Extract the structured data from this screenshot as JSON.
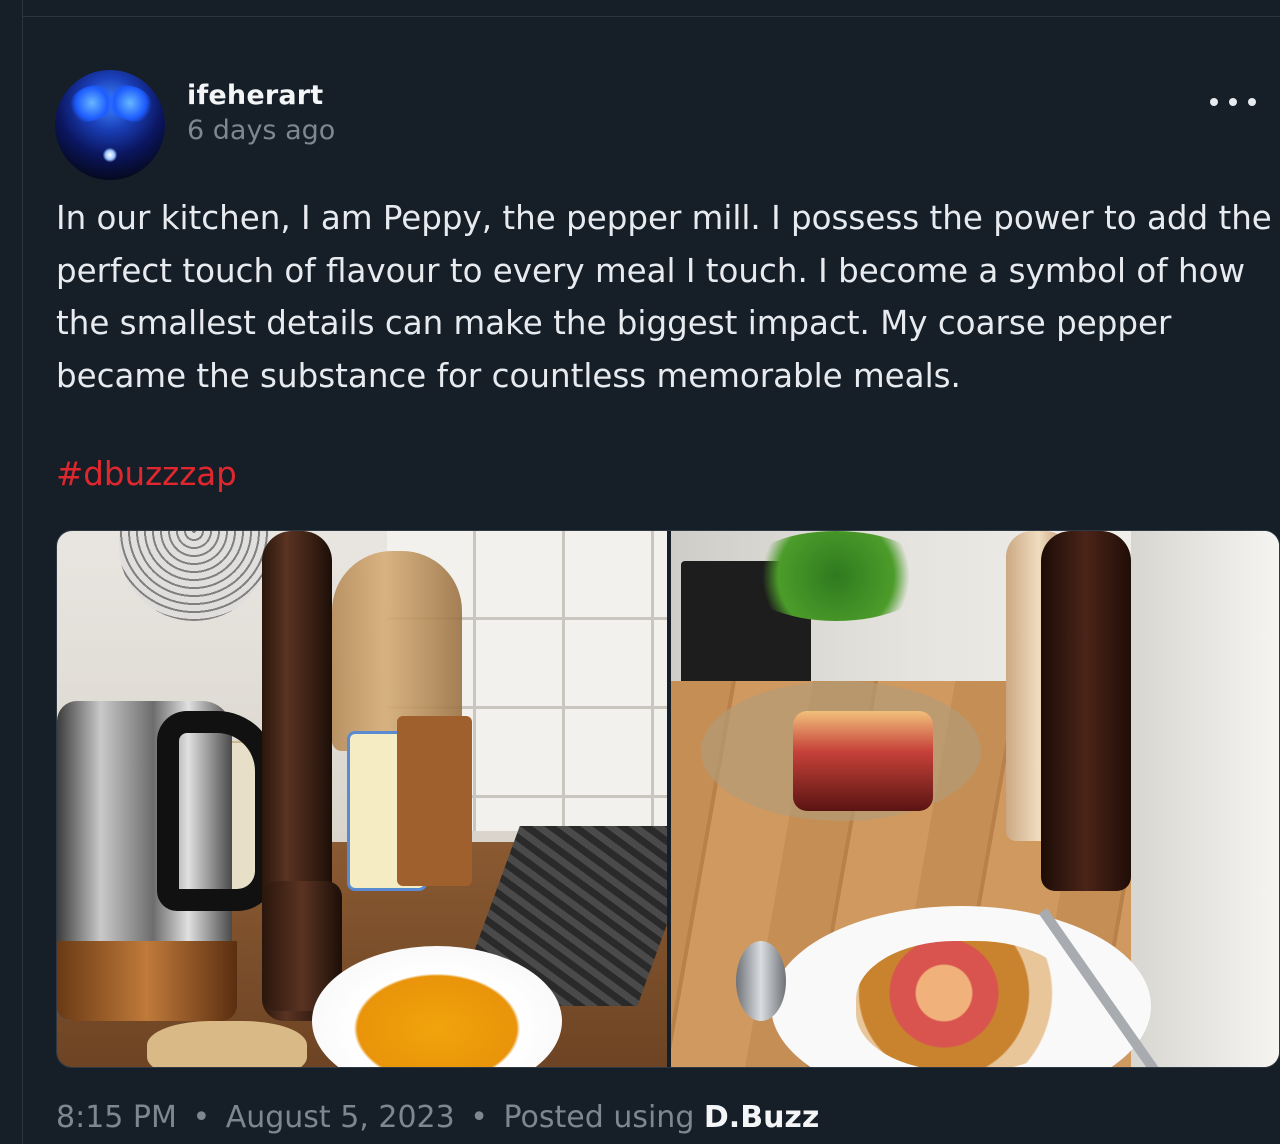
{
  "post": {
    "username": "ifeherart",
    "time_ago": "6 days ago",
    "more_label": "•••",
    "body": "In our kitchen, I am Peppy, the pepper mill. I possess the power to add the perfect touch of flavour to every meal I touch. I become a symbol of how the smallest details can make the biggest impact. My coarse pepper became the substance for countless memorable meals.",
    "hashtag": "#dbuzzzap",
    "hashtag_color": "#e0272e",
    "images": [
      {
        "alt": "kitchen counter with pepper mill, kettle and bowl of soup"
      },
      {
        "alt": "wooden counter with pepper mills, candle and plate of shrimp pasta"
      }
    ],
    "meta": {
      "time": "8:15 PM",
      "separator": "•",
      "date": "August 5, 2023",
      "posted_using": "Posted using",
      "app_name": "D.Buzz"
    }
  },
  "colors": {
    "background": "#161e27",
    "text": "#e7ebef",
    "muted": "#7c8791",
    "accent": "#e0272e"
  },
  "icons": {
    "more": "more-horizontal-icon"
  }
}
